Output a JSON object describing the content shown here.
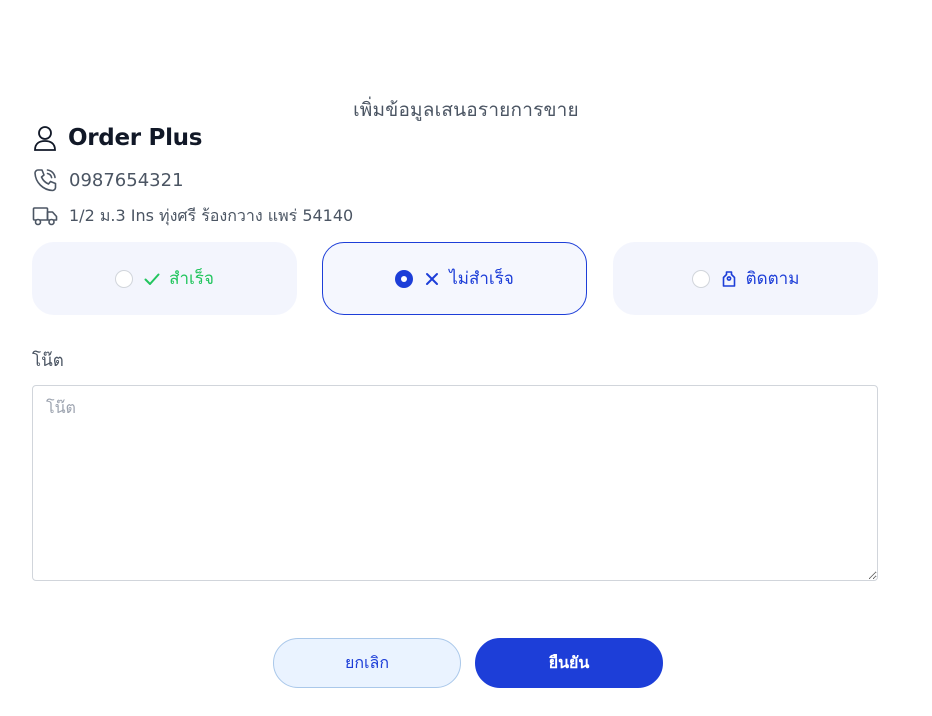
{
  "dialog": {
    "title": "เพิ่มข้อมูลเสนอรายการขาย"
  },
  "customer": {
    "name": "Order Plus",
    "phone": "0987654321",
    "address": "1/2 ม.3 Ins ทุ่งศรี ร้องกวาง แพร่ 54140",
    "icons": [
      "user-icon",
      "phone-icon",
      "truck-icon"
    ]
  },
  "status_options": [
    {
      "label": "สำเร็จ",
      "icon": "check-icon",
      "selected": false,
      "color": "#22c55e"
    },
    {
      "label": "ไม่สำเร็จ",
      "icon": "x-icon",
      "selected": true,
      "color": "#1d3ed8"
    },
    {
      "label": "ติดตาม",
      "icon": "tag-icon",
      "selected": false,
      "color": "#1d3ed8"
    }
  ],
  "note": {
    "label": "โน๊ต",
    "placeholder": "โน๊ต",
    "value": ""
  },
  "buttons": {
    "cancel_label": "ยกเลิก",
    "confirm_label": "ยืนยัน"
  },
  "colors": {
    "accent": "#1d3ed8",
    "success": "#22c55e",
    "option_bg": "#f3f5fd",
    "cancel_bg": "#eaf3ff"
  }
}
